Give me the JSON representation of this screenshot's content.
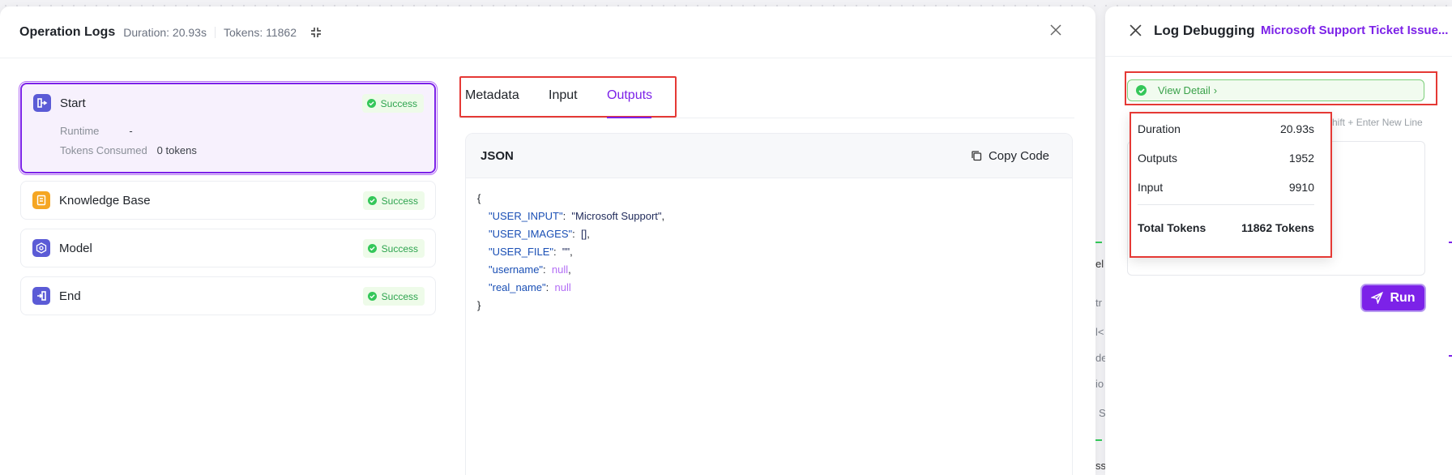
{
  "op_logs": {
    "title": "Operation Logs",
    "duration": "Duration: 20.93s",
    "tokens": "Tokens: 11862",
    "nodes": [
      {
        "name": "Start",
        "status": "Success",
        "runtime_label": "Runtime",
        "runtime_value": "-",
        "tokens_label": "Tokens Consumed",
        "tokens_value": "0 tokens",
        "icon": "start-icon",
        "color": "#5b5bd6"
      },
      {
        "name": "Knowledge Base",
        "status": "Success",
        "icon": "knowledge-base-icon",
        "color": "#f5a623"
      },
      {
        "name": "Model",
        "status": "Success",
        "icon": "model-icon",
        "color": "#5b5bd6"
      },
      {
        "name": "End",
        "status": "Success",
        "icon": "end-icon",
        "color": "#5b5bd6"
      }
    ],
    "tabs": [
      "Metadata",
      "Input",
      "Outputs"
    ],
    "active_tab": "Outputs",
    "json_panel": {
      "lang": "JSON",
      "copy_label": "Copy Code",
      "open_brace": "{",
      "close_brace": "}",
      "lines": [
        {
          "key": "\"USER_INPUT\"",
          "value": "\"Microsoft Support\"",
          "type": "string",
          "comma": ","
        },
        {
          "key": "\"USER_IMAGES\"",
          "value": "[]",
          "type": "string",
          "comma": ","
        },
        {
          "key": "\"USER_FILE\"",
          "value": "\"\"",
          "type": "string",
          "comma": ","
        },
        {
          "key": "\"username\"",
          "value": "null",
          "type": "null",
          "comma": ","
        },
        {
          "key": "\"real_name\"",
          "value": "null",
          "type": "null",
          "comma": ""
        }
      ]
    }
  },
  "behind_text": [
    "el",
    "tr",
    "l<",
    "de",
    "io",
    "S",
    "ss"
  ],
  "drawer": {
    "title": "Log Debugging",
    "subtitle": "Microsoft Support Ticket Issue...",
    "view_detail": "View Detail",
    "hint": "Shift + Enter New Line",
    "tokens_popup": {
      "rows": [
        {
          "label": "Duration",
          "value": "20.93s"
        },
        {
          "label": "Outputs",
          "value": "1952"
        },
        {
          "label": "Input",
          "value": "9910"
        }
      ],
      "total_label": "Total Tokens",
      "total_value": "11862 Tokens"
    },
    "run_label": "Run"
  },
  "colors": {
    "accent": "#7c22e8",
    "success": "#34c759",
    "highlight_box": "#e53935"
  }
}
